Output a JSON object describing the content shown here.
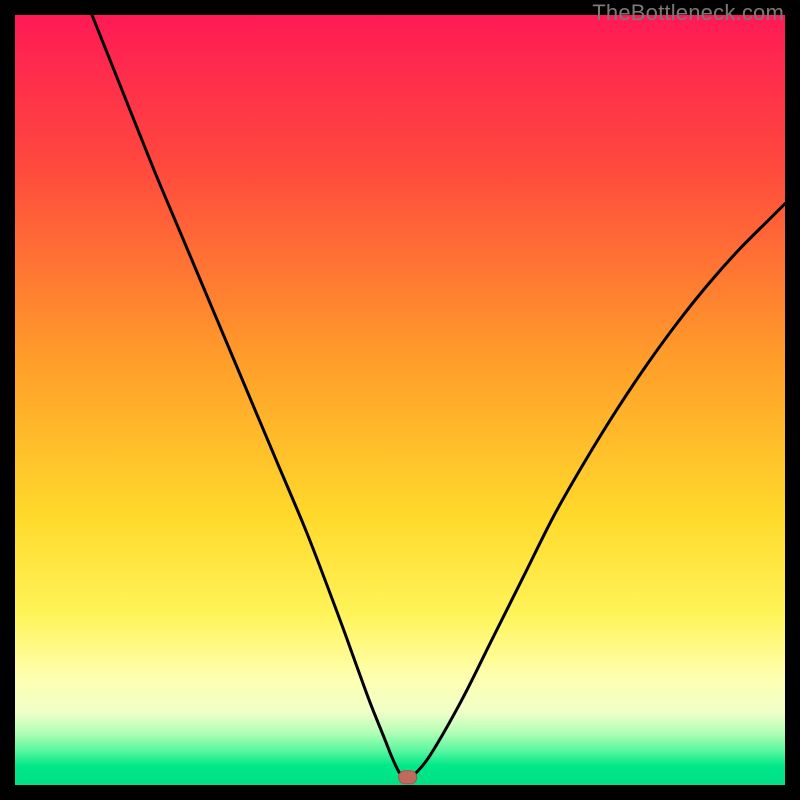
{
  "watermark": "TheBottleneck.com",
  "colors": {
    "black": "#000000",
    "curve": "#000000",
    "marker_fill": "#c1695e",
    "marker_stroke": "#a6544c",
    "gradient_stops": [
      {
        "offset": 0.0,
        "color": "#ff1a55"
      },
      {
        "offset": 0.2,
        "color": "#ff4a3d"
      },
      {
        "offset": 0.45,
        "color": "#ff9e2a"
      },
      {
        "offset": 0.65,
        "color": "#ffd92b"
      },
      {
        "offset": 0.78,
        "color": "#fff45a"
      },
      {
        "offset": 0.86,
        "color": "#ffffb0"
      },
      {
        "offset": 0.905,
        "color": "#f0ffc8"
      },
      {
        "offset": 0.93,
        "color": "#b8ffb8"
      },
      {
        "offset": 0.955,
        "color": "#5cf7a0"
      },
      {
        "offset": 0.975,
        "color": "#00e889"
      },
      {
        "offset": 1.0,
        "color": "#00e084"
      }
    ]
  },
  "chart_data": {
    "type": "line",
    "title": "",
    "xlabel": "",
    "ylabel": "",
    "x_range": [
      0,
      100
    ],
    "y_range": [
      0,
      100
    ],
    "grid": false,
    "legend": false,
    "annotations": [],
    "series": [
      {
        "name": "bottleneck-curve",
        "x": [
          10,
          14,
          18,
          22,
          26,
          30,
          34,
          38,
          42,
          44,
          46,
          48,
          49,
          50,
          51,
          52,
          54,
          58,
          62,
          66,
          70,
          74,
          78,
          82,
          86,
          90,
          94,
          98,
          100
        ],
        "y": [
          100,
          90,
          80,
          70.5,
          61,
          51.5,
          42,
          32.5,
          22,
          16.5,
          11,
          6,
          3.5,
          1.5,
          1,
          1.5,
          4,
          11,
          19,
          27,
          35,
          42,
          48.5,
          54.5,
          60,
          65,
          69.5,
          73.5,
          75.5
        ]
      }
    ],
    "marker": {
      "x": 51,
      "y": 1
    },
    "flat_min_segment": {
      "x_start": 49,
      "x_end": 53,
      "y": 1
    }
  }
}
